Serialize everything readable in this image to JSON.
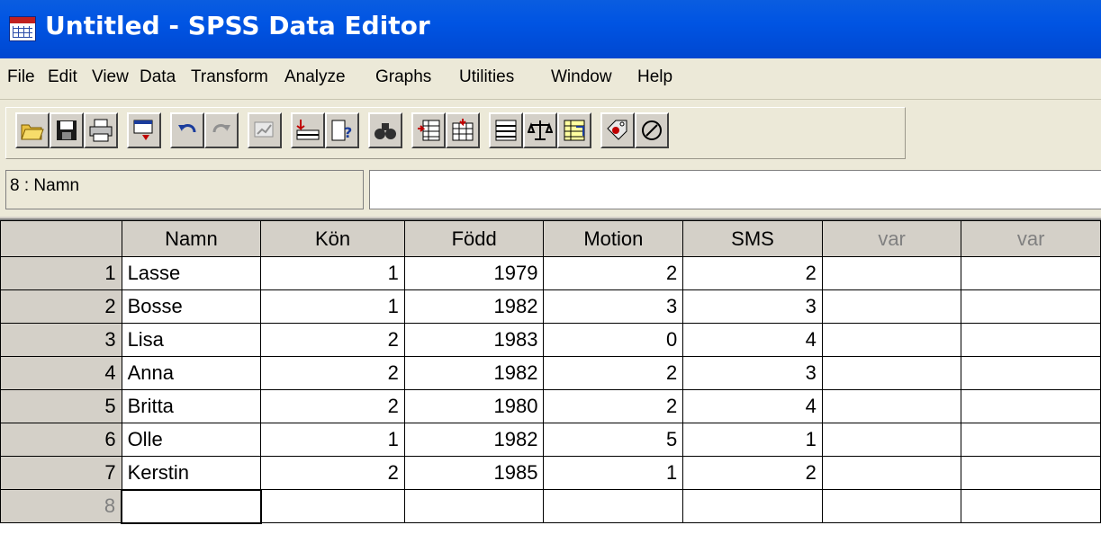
{
  "window": {
    "title": "Untitled - SPSS Data Editor"
  },
  "menu": [
    "File",
    "Edit",
    "View",
    "Data",
    "Transform",
    "Analyze",
    "Graphs",
    "Utilities",
    "Window",
    "Help"
  ],
  "toolbar": [
    "open-icon",
    "save-icon",
    "print-icon",
    "dialog-recall-icon",
    "undo-icon",
    "redo-icon",
    "goto-chart-icon",
    "goto-case-icon",
    "variables-icon",
    "find-icon",
    "insert-cases-icon",
    "insert-variable-icon",
    "split-file-icon",
    "weight-cases-icon",
    "select-cases-icon",
    "value-labels-icon",
    "use-sets-icon"
  ],
  "cell_ref": "8 : Namn",
  "columns": [
    "Namn",
    "Kön",
    "Född",
    "Motion",
    "SMS",
    "var",
    "var"
  ],
  "rows": [
    {
      "n": "1",
      "namn": "Lasse",
      "kon": "1",
      "fodd": "1979",
      "motion": "2",
      "sms": "2"
    },
    {
      "n": "2",
      "namn": "Bosse",
      "kon": "1",
      "fodd": "1982",
      "motion": "3",
      "sms": "3"
    },
    {
      "n": "3",
      "namn": "Lisa",
      "kon": "2",
      "fodd": "1983",
      "motion": "0",
      "sms": "4"
    },
    {
      "n": "4",
      "namn": "Anna",
      "kon": "2",
      "fodd": "1982",
      "motion": "2",
      "sms": "3"
    },
    {
      "n": "5",
      "namn": "Britta",
      "kon": "2",
      "fodd": "1980",
      "motion": "2",
      "sms": "4"
    },
    {
      "n": "6",
      "namn": "Olle",
      "kon": "1",
      "fodd": "1982",
      "motion": "5",
      "sms": "1"
    },
    {
      "n": "7",
      "namn": "Kerstin",
      "kon": "2",
      "fodd": "1985",
      "motion": "1",
      "sms": "2"
    },
    {
      "n": "8",
      "namn": "",
      "kon": "",
      "fodd": "",
      "motion": "",
      "sms": ""
    }
  ]
}
